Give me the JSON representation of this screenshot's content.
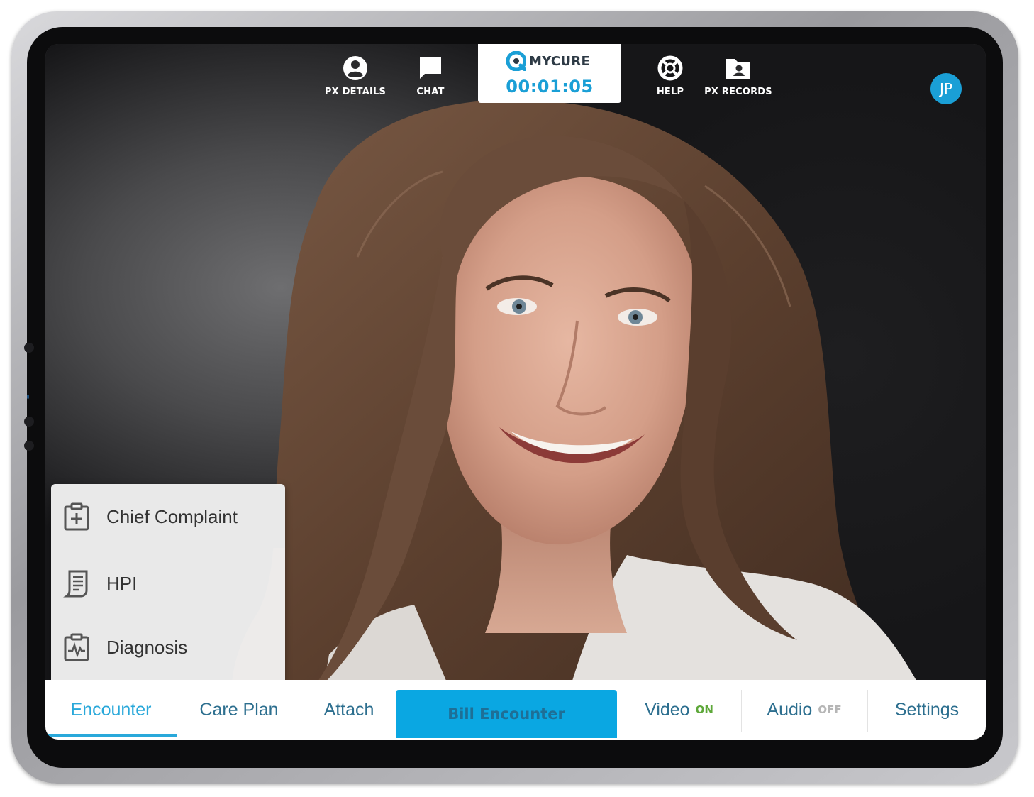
{
  "brand": {
    "name": "MYCURE",
    "timer": "00:01:05",
    "accent_color": "#1a9fd6"
  },
  "top_nav": {
    "px_details": {
      "label": "PX DETAILS",
      "icon": "account-circle-icon"
    },
    "chat": {
      "label": "CHAT",
      "icon": "chat-bubble-icon"
    },
    "help": {
      "label": "HELP",
      "icon": "lifebuoy-icon"
    },
    "px_records": {
      "label": "PX RECORDS",
      "icon": "folder-user-icon"
    }
  },
  "user": {
    "initials": "JP"
  },
  "encounter_menu": {
    "items": [
      {
        "label": "Chief Complaint",
        "icon": "clipboard-plus-icon",
        "active": true
      },
      {
        "label": "HPI",
        "icon": "document-scroll-icon",
        "active": false
      },
      {
        "label": "Diagnosis",
        "icon": "clipboard-pulse-icon",
        "active": false
      }
    ]
  },
  "bottom_bar": {
    "encounter": "Encounter",
    "care_plan": "Care Plan",
    "attach": "Attach",
    "bill_encounter": "Bill Encounter",
    "video": {
      "label": "Video",
      "state": "ON"
    },
    "audio": {
      "label": "Audio",
      "state": "OFF"
    },
    "settings": "Settings",
    "active_tab": "Encounter"
  }
}
